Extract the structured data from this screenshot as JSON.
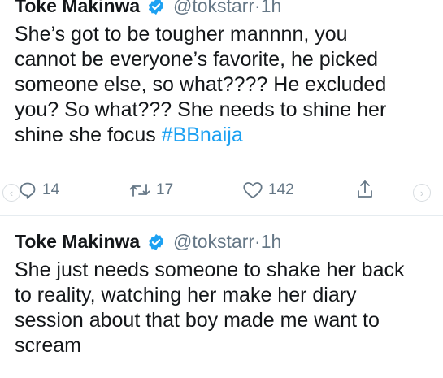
{
  "tweets": [
    {
      "name": "Toke Makinwa",
      "handle": "@tokstarr",
      "dot": "·",
      "time": "1h",
      "lines": [
        "She’s got to be tougher mannnn, you",
        "cannot be everyone’s favorite, he picked",
        "someone else, so what???? He excluded",
        "you? So what??? She needs to shine her"
      ],
      "last_line_prefix": "shine she focus ",
      "hashtag": "#BBnaija",
      "replies": "14",
      "retweets": "17",
      "likes": "142"
    },
    {
      "name": "Toke Makinwa",
      "handle": "@tokstarr",
      "dot": "·",
      "time": "1h",
      "lines": [
        "She just needs someone to shake her back",
        "to reality, watching her make her diary",
        "session about that boy made me want to",
        "scream"
      ]
    }
  ],
  "nav": {
    "prev": "‹",
    "next": "›"
  },
  "icons": {
    "reply": "reply-icon",
    "retweet": "retweet-icon",
    "like": "heart-icon",
    "share": "share-icon",
    "verified": "verified-badge-icon"
  },
  "colors": {
    "link": "#1da1f2",
    "muted": "#657786",
    "text": "#14171a",
    "verified": "#1da1f2"
  }
}
